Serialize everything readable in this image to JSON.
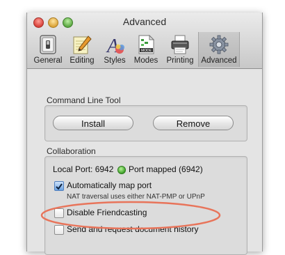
{
  "window": {
    "title": "Advanced"
  },
  "toolbar": {
    "items": [
      {
        "label": "General",
        "icon": "switch-icon"
      },
      {
        "label": "Editing",
        "icon": "notepad-pencil-icon"
      },
      {
        "label": "Styles",
        "icon": "styles-letter-icon"
      },
      {
        "label": "Modes",
        "icon": "mode-document-icon"
      },
      {
        "label": "Printing",
        "icon": "printer-icon"
      },
      {
        "label": "Advanced",
        "icon": "gear-icon"
      }
    ],
    "selected": "Advanced"
  },
  "command_line_tool": {
    "title": "Command Line Tool",
    "install_label": "Install",
    "remove_label": "Remove"
  },
  "collaboration": {
    "title": "Collaboration",
    "local_port_label": "Local Port: 6942",
    "port_status": "Port mapped (6942)",
    "status_color": "#3fa22a",
    "auto_map_label": "Automatically map port",
    "auto_map_checked": true,
    "nat_note": "NAT traversal uses either NAT-PMP or UPnP",
    "disable_friendcasting_label": "Disable Friendcasting",
    "disable_friendcasting_checked": false,
    "send_history_label": "Send and request document history",
    "send_history_checked": false
  },
  "annotation": {
    "color": "#e8745a"
  }
}
